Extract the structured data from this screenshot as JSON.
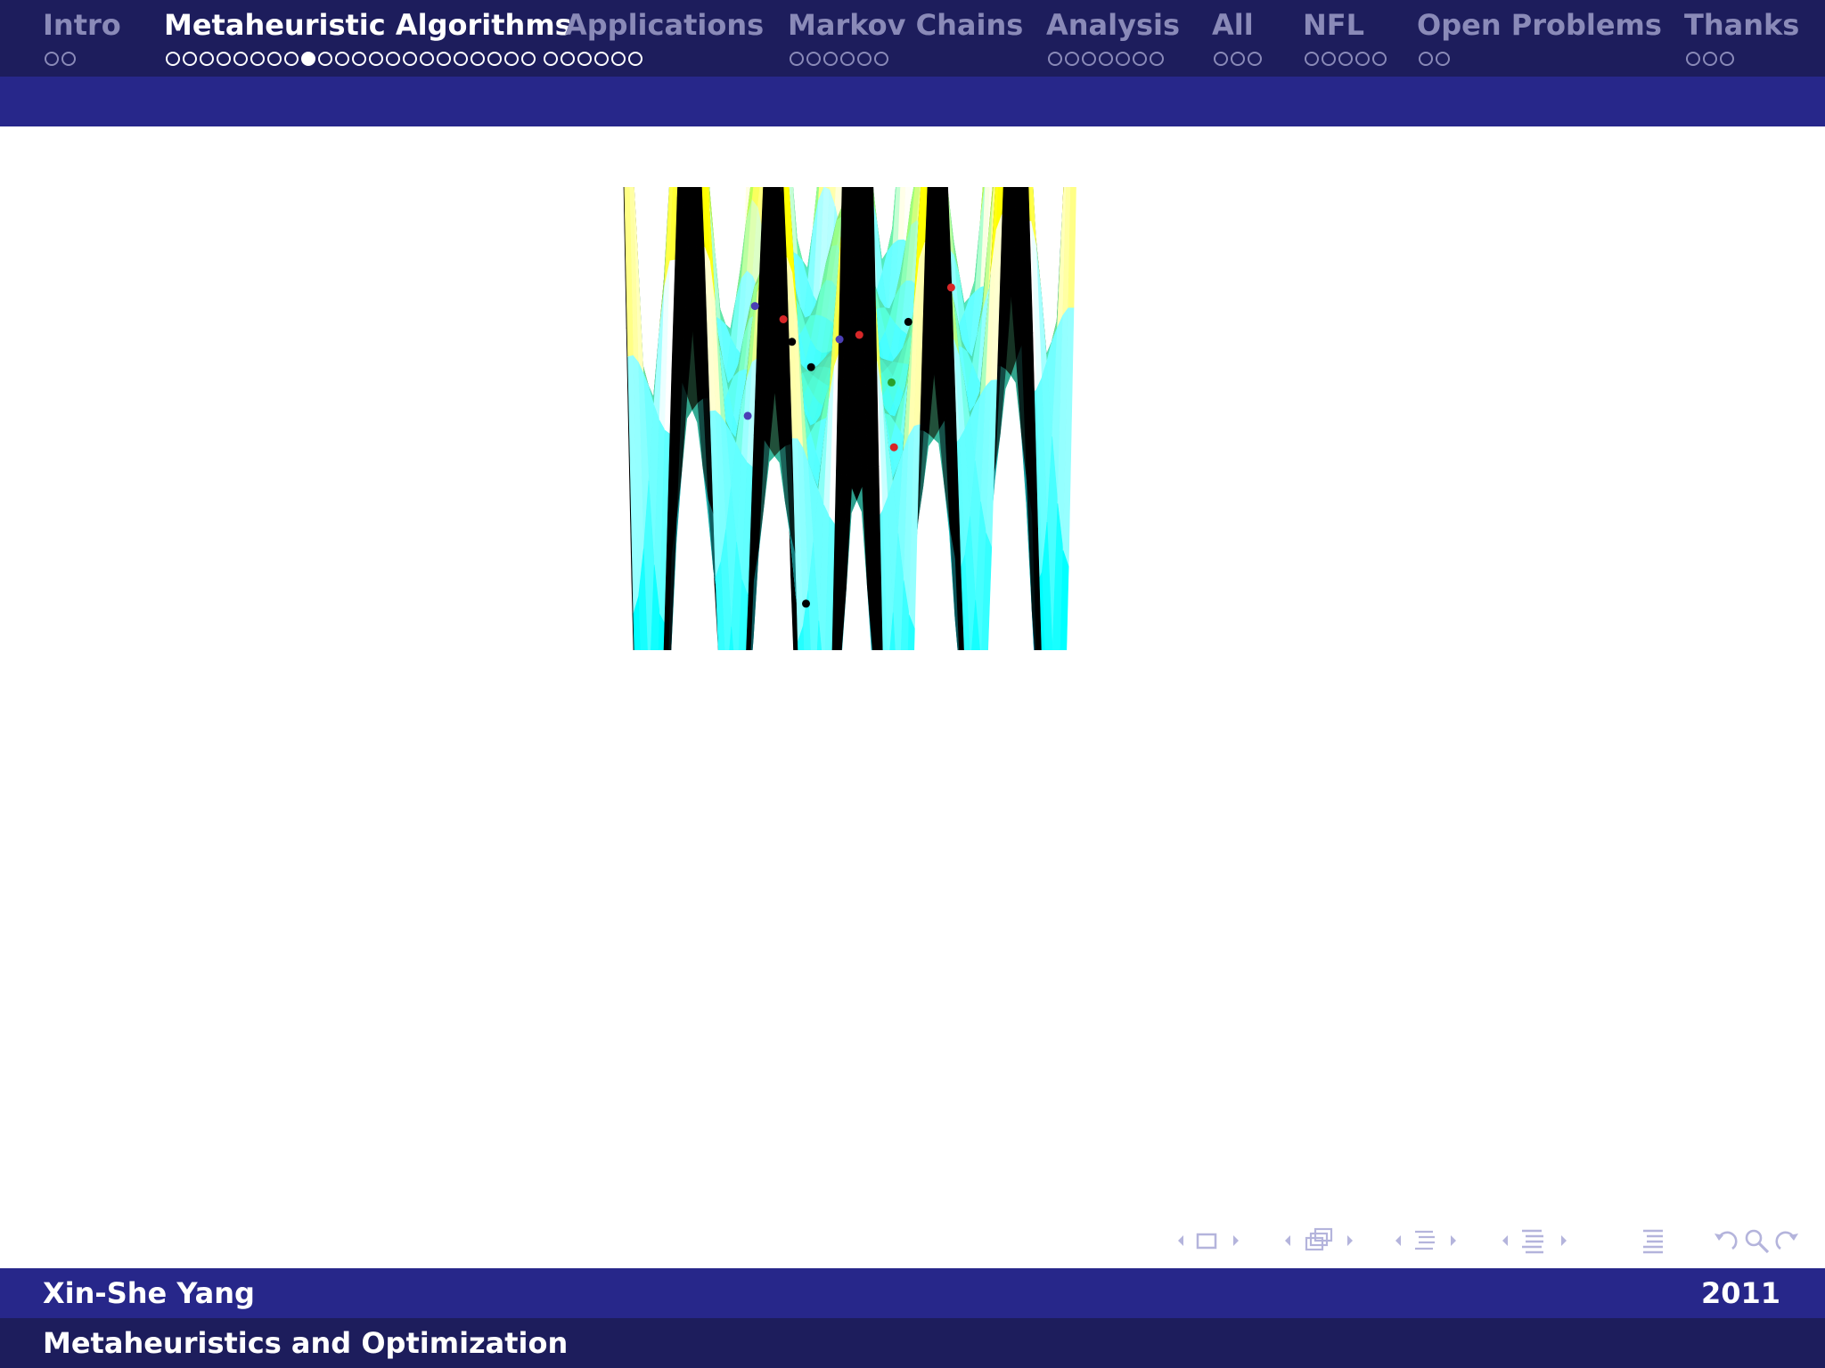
{
  "nav": {
    "sections": [
      {
        "title": "Intro",
        "dots": [
          2
        ],
        "current": -1
      },
      {
        "title": "Metaheuristic Algorithms",
        "dots": [
          22,
          6
        ],
        "current": 8
      },
      {
        "title": "Applications",
        "dots": [],
        "current": -1
      },
      {
        "title": "Markov Chains",
        "dots": [
          6
        ],
        "current": -1
      },
      {
        "title": "Analysis",
        "dots": [
          7
        ],
        "current": -1
      },
      {
        "title": "All",
        "dots": [
          3
        ],
        "current": -1
      },
      {
        "title": "NFL",
        "dots": [
          5
        ],
        "current": -1
      },
      {
        "title": "Open Problems",
        "dots": [
          2
        ],
        "current": -1
      },
      {
        "title": "Thanks",
        "dots": [
          3
        ],
        "current": -1
      }
    ]
  },
  "figure": {
    "type": "3d-surface-with-agents",
    "colormap": [
      "#0a1a8c",
      "#00b4d8",
      "#39e0d0",
      "#e6e600",
      "#ff9a00",
      "#c8102e"
    ],
    "agent_colors": [
      "#000000",
      "#d62728",
      "#4b3fb5",
      "#2aa02a"
    ]
  },
  "beamer_nav": {
    "icons": [
      "frame-nav-icon",
      "subsection-nav-icon",
      "section-nav-icon",
      "presentation-nav-icon",
      "toc-icon",
      "undo-icon",
      "search-icon",
      "redo-icon"
    ]
  },
  "footer": {
    "author": "Xin-She Yang",
    "year": "2011",
    "title": "Metaheuristics and Optimization"
  }
}
